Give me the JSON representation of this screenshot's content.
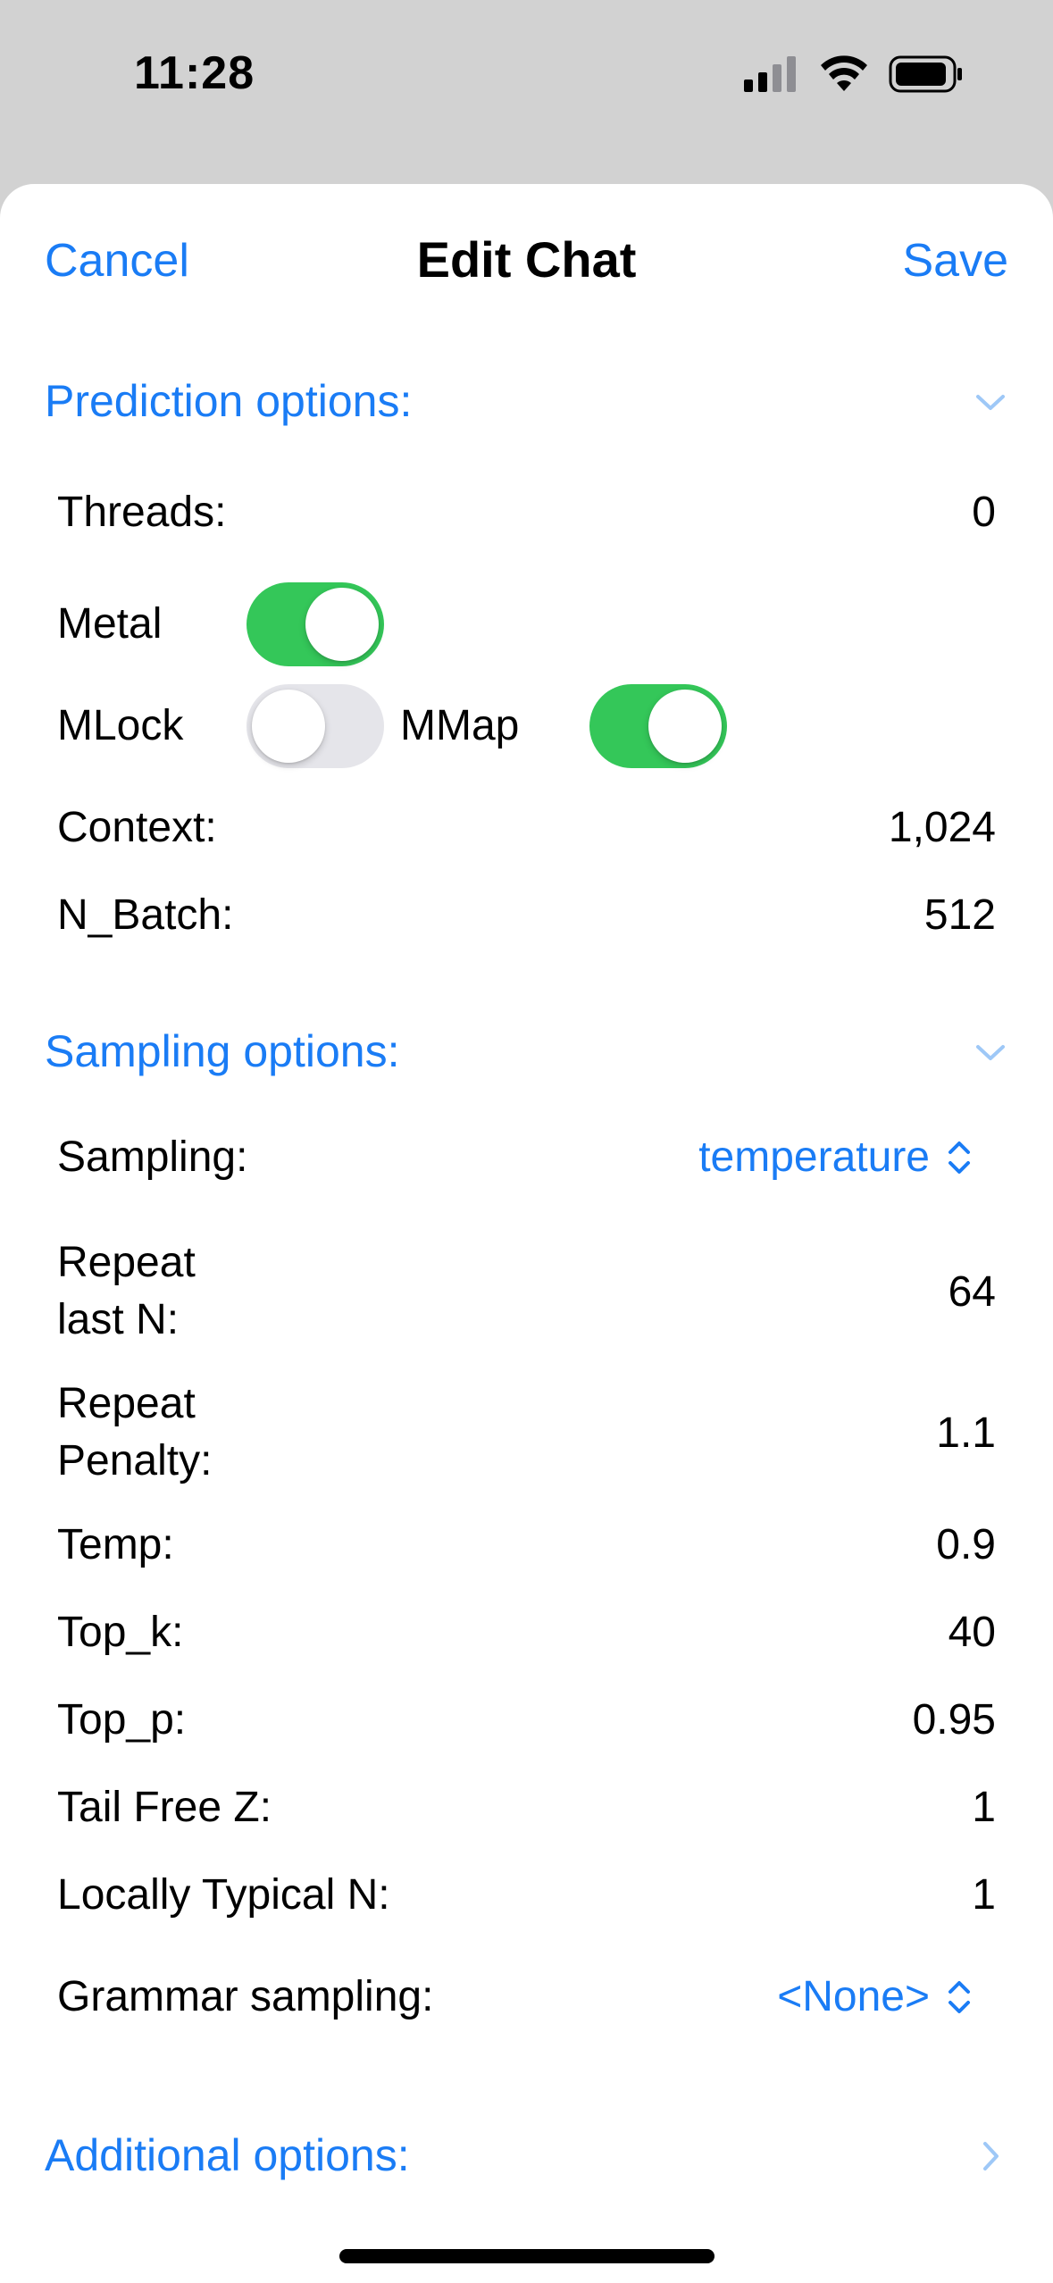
{
  "status": {
    "time": "11:28"
  },
  "nav": {
    "cancel_label": "Cancel",
    "title": "Edit Chat",
    "save_label": "Save"
  },
  "prediction": {
    "title": "Prediction options:",
    "expanded": true,
    "threads_label": "Threads:",
    "threads_value": "0",
    "metal_label": "Metal",
    "metal_on": true,
    "mlock_label": "MLock",
    "mlock_on": false,
    "mmap_label": "MMap",
    "mmap_on": true,
    "context_label": "Context:",
    "context_value": "1,024",
    "nbatch_label": "N_Batch:",
    "nbatch_value": "512"
  },
  "sampling": {
    "title": "Sampling options:",
    "expanded": true,
    "sampling_label": "Sampling:",
    "sampling_value": "temperature",
    "repeat_last_n_label_1": "Repeat",
    "repeat_last_n_label_2": "last N:",
    "repeat_last_n_value": "64",
    "repeat_penalty_label_1": "Repeat",
    "repeat_penalty_label_2": "Penalty:",
    "repeat_penalty_value": "1.1",
    "temp_label": "Temp:",
    "temp_value": "0.9",
    "top_k_label": "Top_k:",
    "top_k_value": "40",
    "top_p_label": "Top_p:",
    "top_p_value": "0.95",
    "tail_free_z_label": "Tail Free Z:",
    "tail_free_z_value": "1",
    "locally_typical_label": "Locally Typical N:",
    "locally_typical_value": "1",
    "grammar_label": "Grammar sampling:",
    "grammar_value": "<None>"
  },
  "additional": {
    "title": "Additional options:",
    "expanded": false
  },
  "colors": {
    "accent": "#1a7cf5",
    "toggle_on": "#34c759",
    "toggle_off": "#e5e5ea"
  },
  "icons": {
    "section_expanded": "chevron-down-icon",
    "section_collapsed": "chevron-right-icon",
    "picker": "chevron-up-down-icon"
  }
}
